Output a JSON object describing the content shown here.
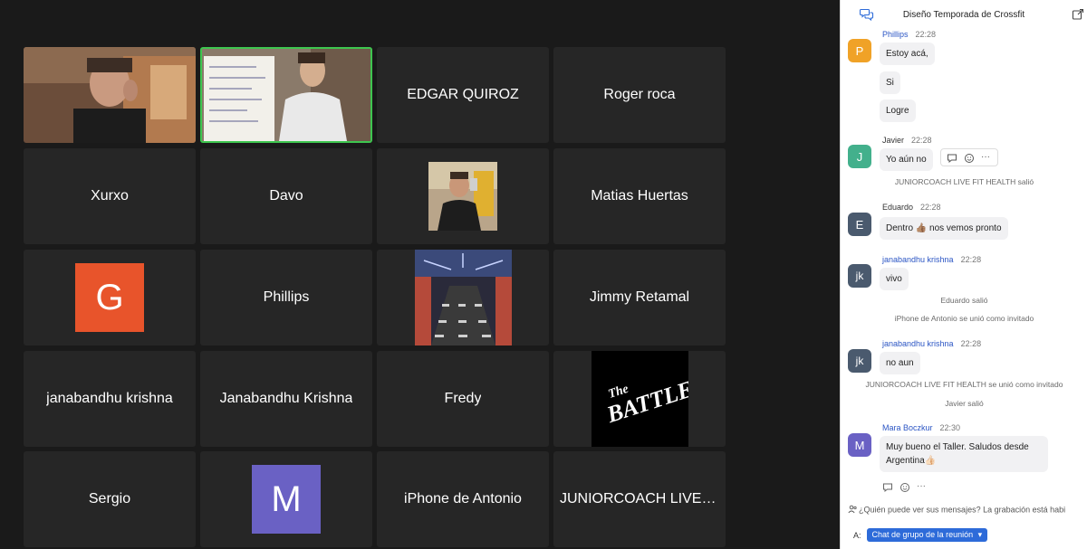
{
  "gallery": {
    "tiles": [
      {
        "kind": "video",
        "label": ""
      },
      {
        "kind": "video",
        "label": ""
      },
      {
        "kind": "name",
        "label": "EDGAR QUIROZ"
      },
      {
        "kind": "name",
        "label": "Roger roca"
      },
      {
        "kind": "name",
        "label": "Xurxo"
      },
      {
        "kind": "name",
        "label": "Davo"
      },
      {
        "kind": "photo",
        "label": ""
      },
      {
        "kind": "name",
        "label": "Matias Huertas"
      },
      {
        "kind": "avatar",
        "label": "G",
        "color": "#e8542b"
      },
      {
        "kind": "name",
        "label": "Phillips"
      },
      {
        "kind": "photo",
        "label": ""
      },
      {
        "kind": "name",
        "label": "Jimmy Retamal"
      },
      {
        "kind": "name",
        "label": "janabandhu krishna"
      },
      {
        "kind": "name",
        "label": "Janabandhu Krishna"
      },
      {
        "kind": "name",
        "label": "Fredy"
      },
      {
        "kind": "logo",
        "label": "The BATTLE"
      },
      {
        "kind": "name",
        "label": "Sergio"
      },
      {
        "kind": "avatar",
        "label": "M",
        "color": "#6a61c4"
      },
      {
        "kind": "name",
        "label": "iPhone de Antonio"
      },
      {
        "kind": "name",
        "label": "JUNIORCOACH LIVE F..."
      }
    ]
  },
  "chat": {
    "title": "Diseño Temporada de Crossfit",
    "messages": [
      {
        "initial": "P",
        "color": "#f0a227",
        "sender": "Phillips",
        "time": "22:28",
        "lines": [
          "Estoy acá,",
          "Si",
          "Logre"
        ]
      },
      {
        "initial": "J",
        "color": "#43b08c",
        "sender": "Javier",
        "time": "22:28",
        "lines": [
          "Yo aún no"
        ]
      },
      {
        "initial": "E",
        "color": "#4a5a6e",
        "sender": "Eduardo",
        "time": "22:28",
        "lines": [
          "Dentro 👍🏽 nos vemos pronto"
        ]
      },
      {
        "initial": "jk",
        "color": "#4a5a6e",
        "sender": "janabandhu krishna",
        "time": "22:28",
        "lines": [
          "vivo"
        ]
      },
      {
        "initial": "jk",
        "color": "#4a5a6e",
        "sender": "janabandhu krishna",
        "time": "22:28",
        "lines": [
          "no aun"
        ]
      },
      {
        "initial": "M",
        "color": "#6a61c4",
        "sender": "Mara Boczkur",
        "time": "22:30",
        "lines": [
          "Muy bueno el Taller. Saludos desde Argentina👍🏻"
        ]
      }
    ],
    "system": [
      "JUNIORCOACH LIVE FIT HEALTH salió",
      "Eduardo salió",
      "iPhone de Antonio se unió como invitado",
      "JUNIORCOACH LIVE FIT HEALTH se unió como invitado",
      "Javier salió"
    ],
    "privacy_text": "¿Quién puede ver sus mensajes? La grabación está habi",
    "recipient_label": "A:",
    "recipient_value": "Chat de grupo de la reunión",
    "more_dots": "···"
  }
}
